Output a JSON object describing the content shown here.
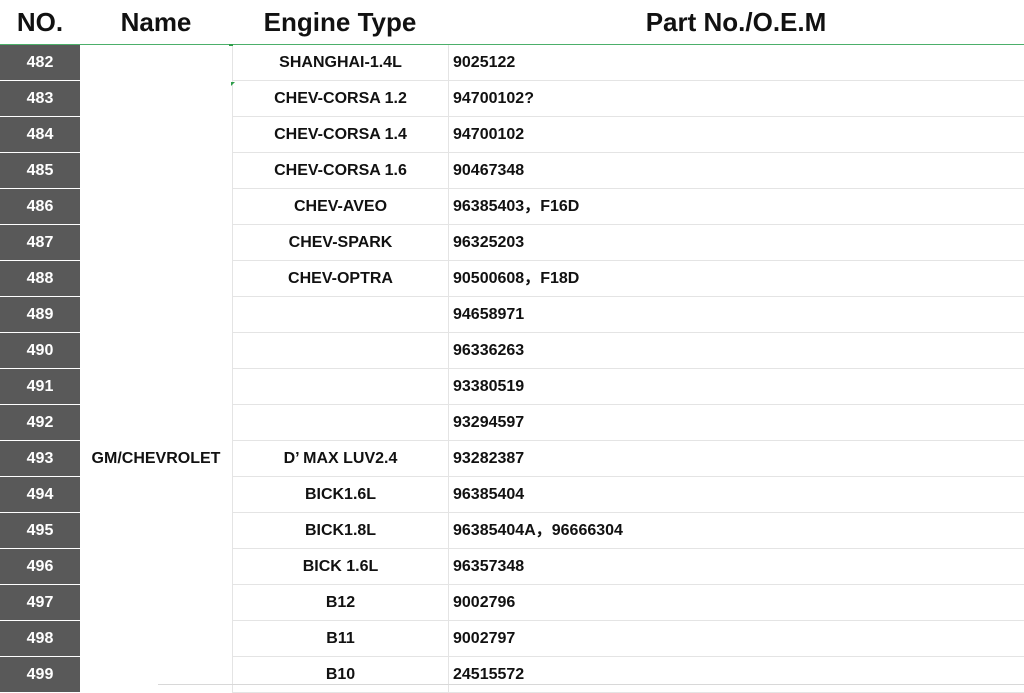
{
  "header": {
    "no": "NO.",
    "name": "Name",
    "engine_type": "Engine Type",
    "part_no": "Part No./O.E.M"
  },
  "group_name": "GM/CHEVROLET",
  "rows": [
    {
      "no": "482",
      "engine": "SHANGHAI-1.4L",
      "part": "9025122"
    },
    {
      "no": "483",
      "engine": "CHEV-CORSA 1.2",
      "part": "94700102?"
    },
    {
      "no": "484",
      "engine": "CHEV-CORSA 1.4",
      "part": "94700102"
    },
    {
      "no": "485",
      "engine": "CHEV-CORSA 1.6",
      "part": "90467348"
    },
    {
      "no": "486",
      "engine": "CHEV-AVEO",
      "part": "96385403，F16D"
    },
    {
      "no": "487",
      "engine": "CHEV-SPARK",
      "part": "96325203"
    },
    {
      "no": "488",
      "engine": "CHEV-OPTRA",
      "part": "90500608，F18D"
    },
    {
      "no": "489",
      "engine": "",
      "part": "94658971"
    },
    {
      "no": "490",
      "engine": "",
      "part": "96336263"
    },
    {
      "no": "491",
      "engine": "",
      "part": "93380519"
    },
    {
      "no": "492",
      "engine": "",
      "part": "93294597"
    },
    {
      "no": "493",
      "engine": "D’  MAX LUV2.4",
      "part": "93282387"
    },
    {
      "no": "494",
      "engine": "BICK1.6L",
      "part": "96385404"
    },
    {
      "no": "495",
      "engine": "BICK1.8L",
      "part": "96385404A，96666304"
    },
    {
      "no": "496",
      "engine": "BICK 1.6L",
      "part": "96357348"
    },
    {
      "no": "497",
      "engine": "B12",
      "part": "9002796"
    },
    {
      "no": "498",
      "engine": "B11",
      "part": "9002797"
    },
    {
      "no": "499",
      "engine": "B10",
      "part": "24515572"
    }
  ]
}
